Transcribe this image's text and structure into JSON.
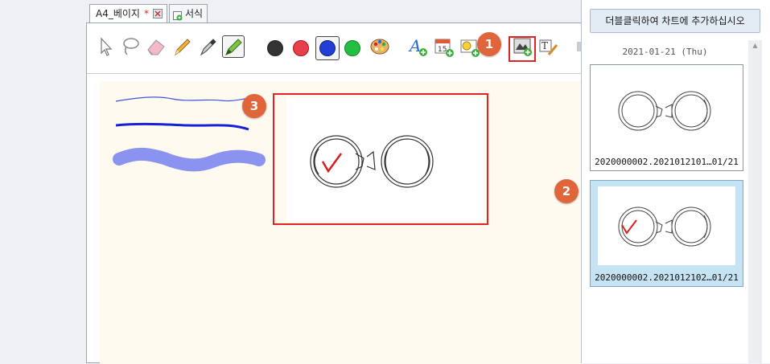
{
  "tabs": [
    {
      "label": "A4_베이지",
      "modified_mark": "*"
    },
    {
      "label": "서식"
    }
  ],
  "toolbar": {
    "tools": [
      "pointer-icon",
      "lasso-icon",
      "eraser-icon",
      "pencil-icon",
      "pen-icon",
      "highlighter-icon"
    ],
    "colors": [
      "#333333",
      "#e8404b",
      "#1f3fd6",
      "#22c040"
    ],
    "palette": "palette-icon",
    "insert_tools": [
      "text-add-icon",
      "date-add-icon",
      "sticker-add-icon",
      "image-add-icon",
      "text-box-icon"
    ],
    "date_icon_text": "15"
  },
  "annotations": {
    "badge_1": "1",
    "badge_2": "2",
    "badge_3": "3"
  },
  "panel": {
    "add_button_label": "더블클릭하여 차트에 추가하십시오",
    "date_header": "2021-01-21 (Thu)",
    "cards": [
      {
        "caption": "2020000002.2021012101…01/21"
      },
      {
        "caption": "2020000002.2021012102…01/21"
      }
    ]
  }
}
